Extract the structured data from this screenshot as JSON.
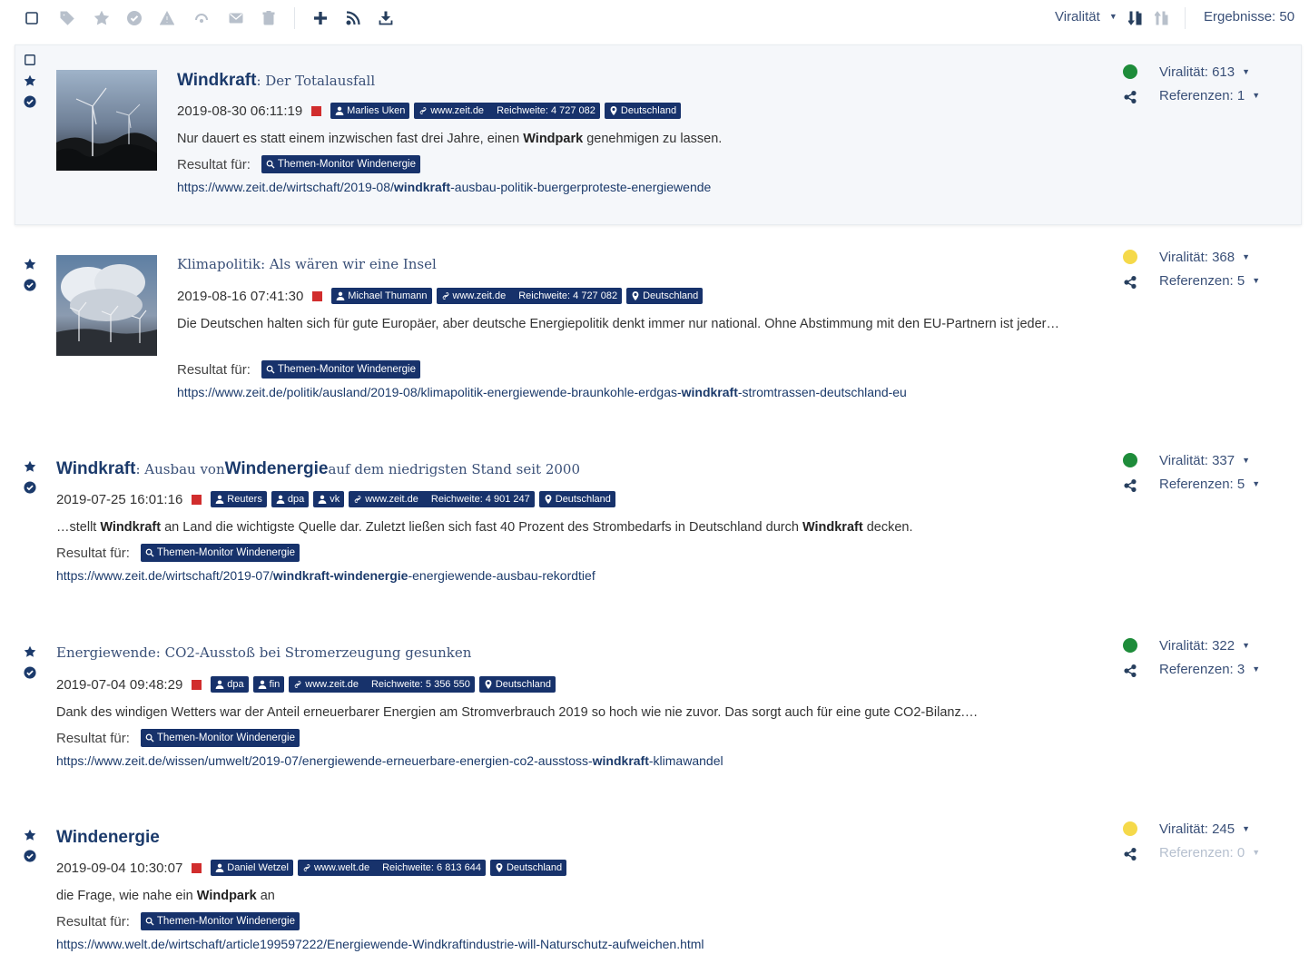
{
  "toolbar": {
    "icons": [
      "checkbox-icon",
      "tag-icon",
      "star-icon",
      "check-circle-icon",
      "warning-icon",
      "rss-off-icon",
      "mail-icon",
      "trash-icon",
      "plus-icon",
      "rss-icon",
      "download-icon"
    ],
    "sort_label": "Viralität",
    "results_label": "Ergebnisse:",
    "results_count": "50"
  },
  "articles": [
    {
      "title_strong": "Windkraft",
      "title_rest": ": Der Totalausfall",
      "date": "2019-08-30 06:11:19",
      "author_badges": [
        "Marlies Uken"
      ],
      "site": "www.zeit.de",
      "reach": "Reichweite: 4 727 082",
      "country": "Deutschland",
      "snippet_parts": [
        {
          "t": "Nur dauert es statt einem inzwischen fast drei Jahre, einen ",
          "b": false
        },
        {
          "t": "Windpark",
          "b": true
        },
        {
          "t": " genehmigen zu lassen.",
          "b": false
        }
      ],
      "result_label": "Resultat für:",
      "result_badge": "Themen-Monitor Windenergie",
      "url_parts": [
        {
          "t": "https://www.zeit.de/wirtschaft/2019-08/",
          "b": false
        },
        {
          "t": "windkraft",
          "b": true
        },
        {
          "t": "-ausbau-politik-buergerproteste-energiewende",
          "b": false
        }
      ],
      "viralitaet": "Viralität: 613",
      "referenzen": "Referenzen: 1",
      "dot_color": "#1e8c3a"
    },
    {
      "title_strong": "",
      "title_rest": "Klimapolitik: Als wären wir eine Insel",
      "date": "2019-08-16 07:41:30",
      "author_badges": [
        "Michael Thumann"
      ],
      "site": "www.zeit.de",
      "reach": "Reichweite: 4 727 082",
      "country": "Deutschland",
      "snippet_parts": [
        {
          "t": "Die Deutschen halten sich für gute Europäer, aber deutsche Energiepolitik denkt immer nur national. Ohne Abstimmung mit den EU-Partnern ist jeder…",
          "b": false
        }
      ],
      "result_label": "Resultat für:",
      "result_badge": "Themen-Monitor Windenergie",
      "url_parts": [
        {
          "t": "https://www.zeit.de/politik/ausland/2019-08/klimapolitik-energiewende-braunkohle-erdgas-",
          "b": false
        },
        {
          "t": "windkraft",
          "b": true
        },
        {
          "t": "-stromtrassen-deutschland-eu",
          "b": false
        }
      ],
      "viralitaet": "Viralität: 368",
      "referenzen": "Referenzen: 5",
      "dot_color": "#f5d94a"
    },
    {
      "title_strong": "Windkraft",
      "title_rest": ": Ausbau von ",
      "title_strong2": "Windenergie",
      "title_rest2": " auf dem niedrigsten Stand seit 2000",
      "date": "2019-07-25 16:01:16",
      "author_badges": [
        "Reuters",
        "dpa",
        "vk"
      ],
      "site": "www.zeit.de",
      "reach": "Reichweite: 4 901 247",
      "country": "Deutschland",
      "snippet_parts": [
        {
          "t": "…stellt ",
          "b": false
        },
        {
          "t": "Windkraft",
          "b": true
        },
        {
          "t": " an Land die wichtigste Quelle dar. Zuletzt ließen sich fast 40 Prozent des Strombedarfs in Deutschland durch ",
          "b": false
        },
        {
          "t": "Windkraft",
          "b": true
        },
        {
          "t": " decken.",
          "b": false
        }
      ],
      "result_label": "Resultat für:",
      "result_badge": "Themen-Monitor Windenergie",
      "url_parts": [
        {
          "t": "https://www.zeit.de/wirtschaft/2019-07/",
          "b": false
        },
        {
          "t": "windkraft-windenergie",
          "b": true
        },
        {
          "t": "-energiewende-ausbau-rekordtief",
          "b": false
        }
      ],
      "viralitaet": "Viralität: 337",
      "referenzen": "Referenzen: 5",
      "dot_color": "#1e8c3a"
    },
    {
      "title_strong": "",
      "title_rest": "Energiewende: CO2-Ausstoß bei Stromerzeugung gesunken",
      "date": "2019-07-04 09:48:29",
      "author_badges": [
        "dpa",
        "fin"
      ],
      "site": "www.zeit.de",
      "reach": "Reichweite: 5 356 550",
      "country": "Deutschland",
      "snippet_parts": [
        {
          "t": "Dank des windigen Wetters war der Anteil erneuerbarer Energien am Stromverbrauch 2019 so hoch wie nie zuvor. Das sorgt auch für eine gute CO2-Bilanz.…",
          "b": false
        }
      ],
      "result_label": "Resultat für:",
      "result_badge": "Themen-Monitor Windenergie",
      "url_parts": [
        {
          "t": "https://www.zeit.de/wissen/umwelt/2019-07/energiewende-erneuerbare-energien-co2-ausstoss-",
          "b": false
        },
        {
          "t": "windkraft",
          "b": true
        },
        {
          "t": "-klimawandel",
          "b": false
        }
      ],
      "viralitaet": "Viralität: 322",
      "referenzen": "Referenzen: 3",
      "dot_color": "#1e8c3a"
    },
    {
      "title_strong": "Windenergie",
      "title_rest": "",
      "date": "2019-09-04 10:30:07",
      "author_badges": [
        "Daniel Wetzel"
      ],
      "site": "www.welt.de",
      "reach": "Reichweite: 6 813 644",
      "country": "Deutschland",
      "snippet_parts": [
        {
          "t": "die Frage, wie nahe ein ",
          "b": false
        },
        {
          "t": "Windpark",
          "b": true
        },
        {
          "t": " an",
          "b": false
        }
      ],
      "result_label": "Resultat für:",
      "result_badge": "Themen-Monitor Windenergie",
      "url_parts": [
        {
          "t": "https://www.welt.de/wirtschaft/article199597222/Energiewende-Windkraftindustrie-will-Naturschutz-aufweichen.html",
          "b": false
        }
      ],
      "viralitaet": "Viralität: 245",
      "referenzen": "Referenzen: 0",
      "dot_color": "#f5d94a"
    }
  ]
}
